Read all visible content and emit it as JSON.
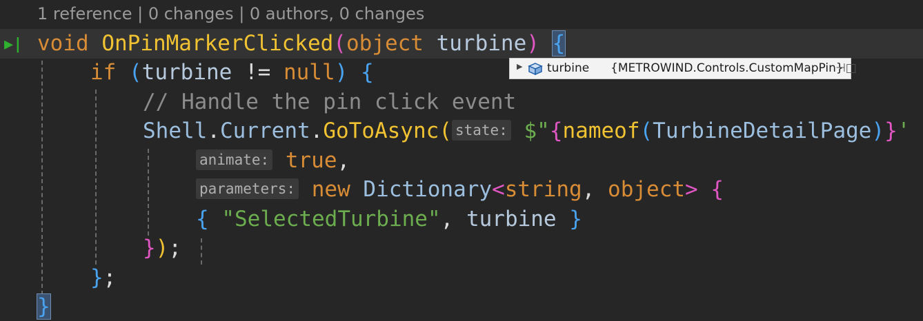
{
  "codelens": {
    "text": "1 reference | 0 changes | 0 authors, 0 changes"
  },
  "code": {
    "l1": {
      "void": "void",
      "method": "OnPinMarkerClicked",
      "paren_open": "(",
      "object": "object",
      "param": "turbine",
      "paren_close": ")",
      "brace": "{"
    },
    "l2": {
      "if": "if",
      "paren_open": "(",
      "var": "turbine",
      "op": " != ",
      "null": "null",
      "paren_close": ")",
      "brace": "{"
    },
    "l3": {
      "comment": "// Handle the pin click event"
    },
    "l4": {
      "shell": "Shell",
      "dot1": ".",
      "current": "Current",
      "dot2": ".",
      "goto": "GoToAsync",
      "paren": "(",
      "hint": "state:",
      "dollar": "$\"",
      "brace": "{",
      "nameof": "nameof",
      "np": "(",
      "page": "TurbineDetailPage",
      "np2": ")",
      "brace2": "}",
      "q": "'"
    },
    "l5": {
      "hint": "animate:",
      "true": "true",
      "comma": ","
    },
    "l6": {
      "hint": "parameters:",
      "new": "new",
      "dict": "Dictionary",
      "lt": "<",
      "string": "string",
      "comma": ", ",
      "object": "object",
      "gt": ">",
      "brace": "{"
    },
    "l7": {
      "brace_open": "{",
      "str": "\"SelectedTurbine\"",
      "comma": ", ",
      "var": "turbine",
      "brace_close": "}"
    },
    "l8": {
      "brace": "}",
      "paren": ")",
      "semi": ";"
    },
    "l9": {
      "brace": "}",
      "semi": ";"
    },
    "l10": {
      "brace": "}"
    }
  },
  "datatip": {
    "name": "turbine",
    "value": "{METROWIND.Controls.CustomMapPin}",
    "icons": [
      "expand-arrow-icon",
      "object-cube-icon",
      "pin-icon"
    ]
  },
  "colors": {
    "background": "#262626",
    "keyword": "#d88c36",
    "method": "#f1c232",
    "type": "#9cbfe0",
    "comment": "#8c8c8c",
    "string": "#6cae4f",
    "brace_blue": "#4aa3f0",
    "brace_pink": "#e056c3"
  }
}
